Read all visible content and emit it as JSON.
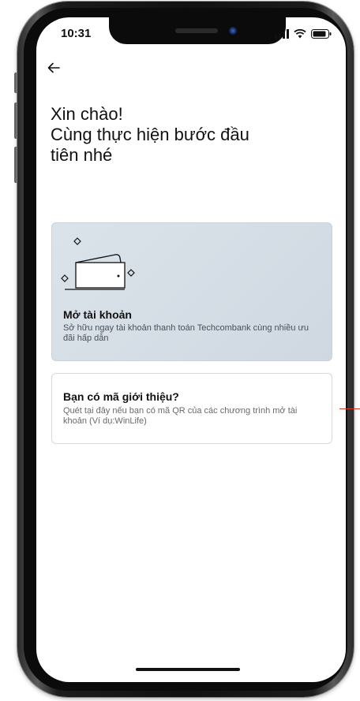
{
  "status_bar": {
    "time": "10:31",
    "signal_icon": "cellular-signal-icon",
    "wifi_icon": "wifi-icon",
    "battery_icon": "battery-icon"
  },
  "nav": {
    "back_icon": "arrow-left-icon"
  },
  "headline": {
    "line1": "Xin chào!",
    "line2": "Cùng thực hiện bước đầu",
    "line3": "tiên nhé"
  },
  "cards": {
    "open_account": {
      "icon": "wallet-icon",
      "title": "Mở tài khoản",
      "description": "Sở hữu ngay tài khoản thanh toán Techcombank cùng nhiều ưu đãi hấp dẫn"
    },
    "referral": {
      "title": "Bạn có mã giới thiệu?",
      "description": "Quét tại đây nếu bạn có mã QR của các chương trình mở tài khoản (Ví dụ:WinLife)"
    }
  },
  "colors": {
    "open_card_bg": "#d5dee6",
    "referral_border": "#d8d8d8",
    "text_primary": "#111111",
    "pointer_red": "#d33a2c"
  }
}
